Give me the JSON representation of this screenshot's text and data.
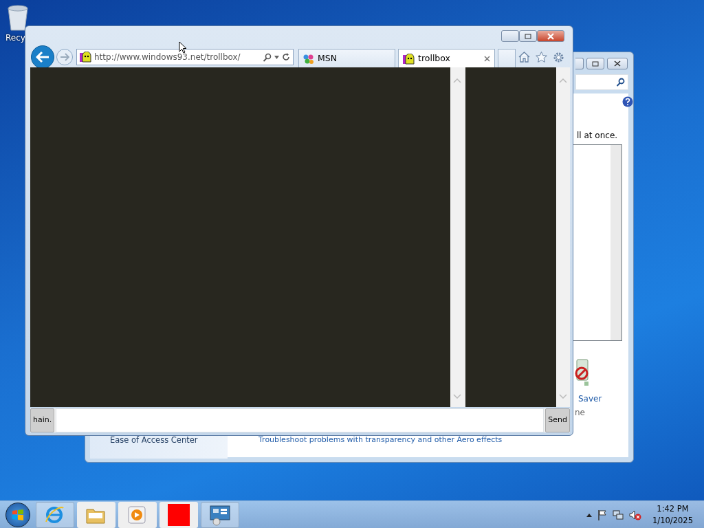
{
  "desktop_icons": [
    {
      "label": "Recy"
    }
  ],
  "background_window": {
    "description_tail": "ll at once.",
    "screen_saver_link": "Saver",
    "screen_saver_value": "ne",
    "sidebar_link": "Ease of Access Center",
    "task_link": "Troubleshoot problems with transparency and other Aero effects"
  },
  "browser": {
    "address": "http://www.windows93.net/trollbox/",
    "tabs": [
      {
        "label": "MSN",
        "selected": false
      },
      {
        "label": "trollbox",
        "selected": true
      }
    ],
    "chat": {
      "name_button": "hain.",
      "send_button": "Send"
    }
  },
  "taskbar": {
    "items": [
      {
        "kind": "browser",
        "open": true
      },
      {
        "kind": "folder",
        "open": false
      },
      {
        "kind": "media",
        "open": false
      },
      {
        "kind": "red",
        "open": false
      },
      {
        "kind": "panel",
        "open": true
      }
    ],
    "volume_muted": true,
    "clock": {
      "time": "1:42 PM",
      "date": "1/10/2025"
    }
  }
}
